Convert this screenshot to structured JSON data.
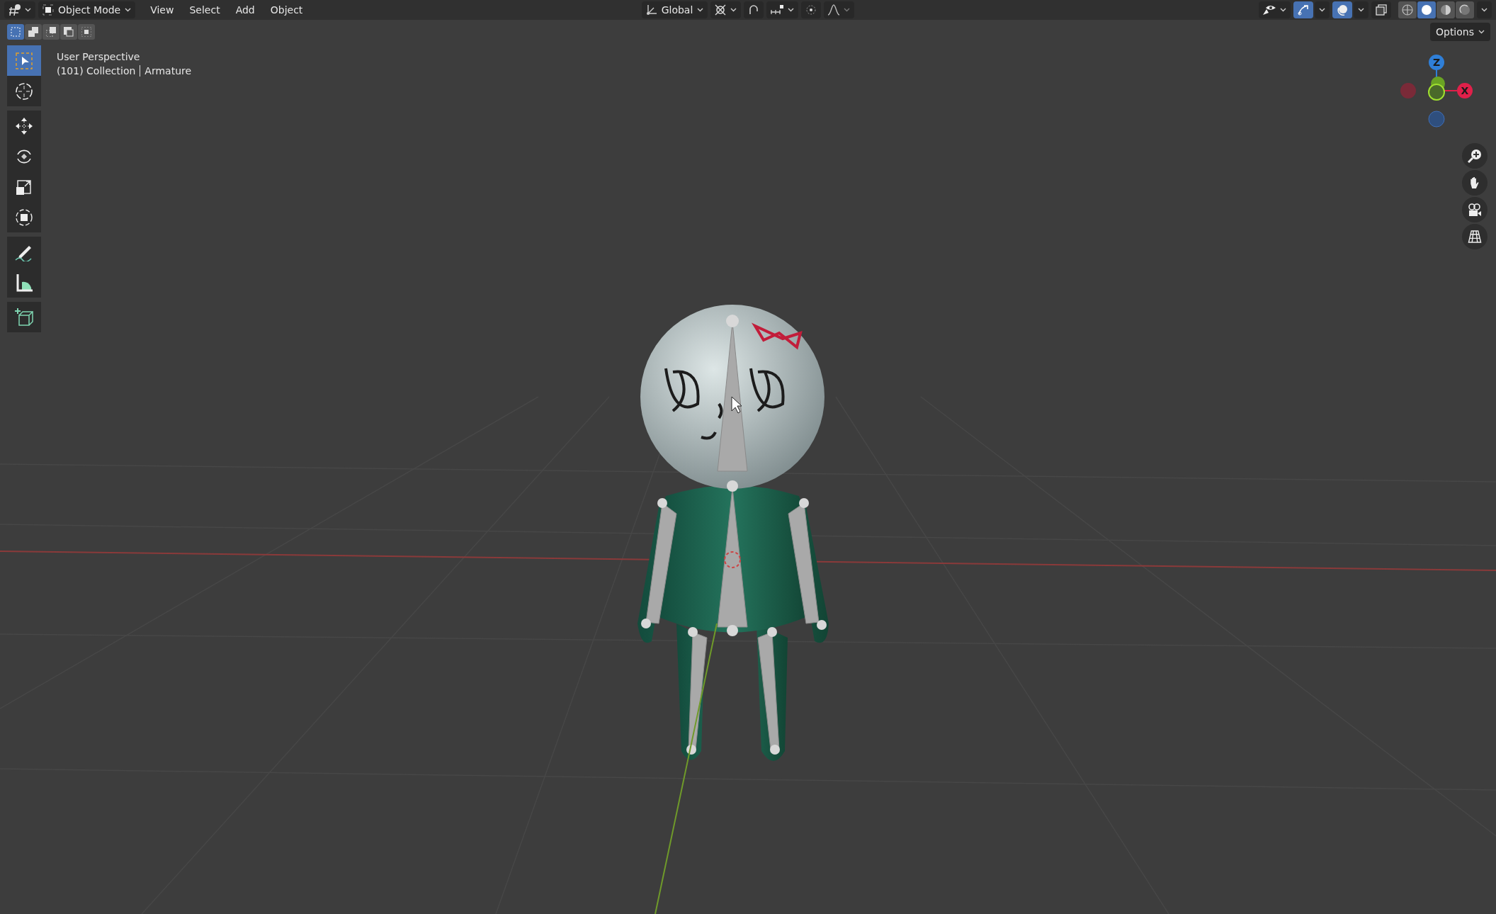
{
  "header": {
    "mode": "Object Mode",
    "menu": [
      "View",
      "Select",
      "Add",
      "Object"
    ],
    "orientation": "Global"
  },
  "header_toggles": [
    {
      "kind": "snap",
      "on": false
    },
    {
      "kind": "proportional",
      "on": false
    },
    {
      "kind": "visibility",
      "on": false
    },
    {
      "kind": "gizmos",
      "on": true
    },
    {
      "kind": "overlays",
      "on": true
    },
    {
      "kind": "xray",
      "on": false
    }
  ],
  "shading_modes": [
    {
      "kind": "wireframe",
      "selected": false
    },
    {
      "kind": "solid",
      "selected": true
    },
    {
      "kind": "material",
      "selected": false
    },
    {
      "kind": "rendered",
      "selected": false
    }
  ],
  "select_modes": [
    {
      "kind": "new",
      "selected": true
    },
    {
      "kind": "extend",
      "selected": false
    },
    {
      "kind": "subtract",
      "selected": false
    },
    {
      "kind": "invert",
      "selected": false
    },
    {
      "kind": "intersect",
      "selected": false
    }
  ],
  "options": "Options",
  "tools": [
    {
      "kind": "select",
      "selected": true
    },
    {
      "kind": "cursor",
      "selected": false
    },
    {
      "kind": "move",
      "selected": false
    },
    {
      "kind": "rotate",
      "selected": false
    },
    {
      "kind": "scale",
      "selected": false
    },
    {
      "kind": "transform",
      "selected": false
    },
    {
      "kind": "annotate",
      "selected": false
    },
    {
      "kind": "measure",
      "selected": false
    },
    {
      "kind": "add-cube",
      "selected": false
    }
  ],
  "viewport": {
    "perspective": "User Perspective",
    "collection": "(101) Collection",
    "object": "Armature"
  },
  "gizmo": {
    "axes": [
      {
        "kind": "z",
        "label": "Z"
      },
      {
        "kind": "x",
        "label": "X"
      }
    ]
  }
}
